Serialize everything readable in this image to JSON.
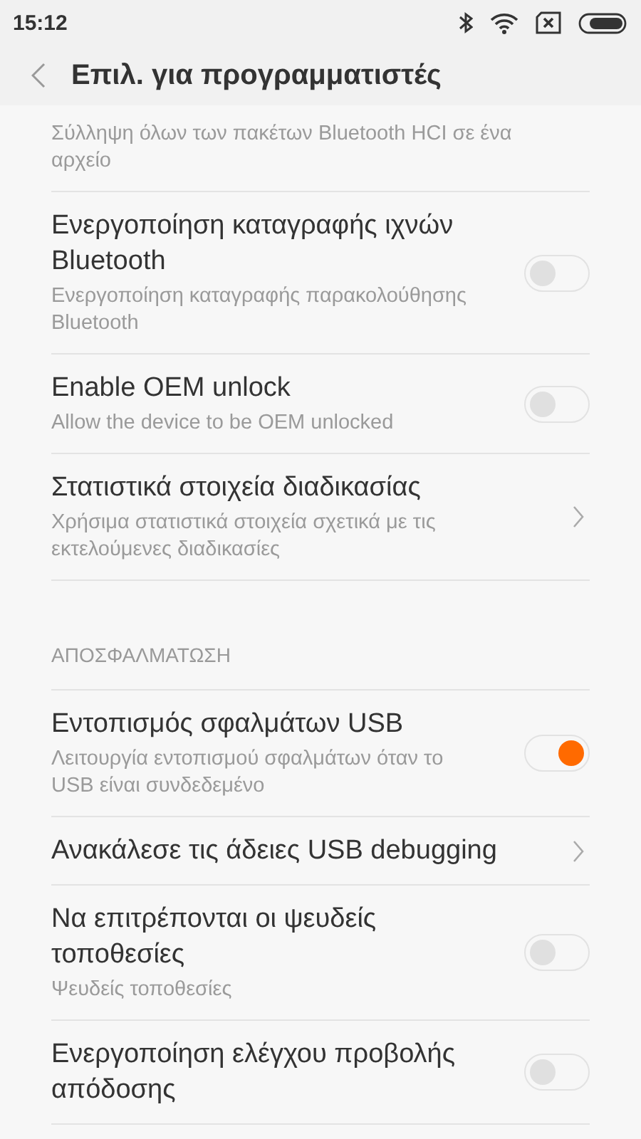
{
  "status_bar": {
    "time": "15:12"
  },
  "header": {
    "title": "Επιλ. για προγραμματιστές"
  },
  "sections": [
    {
      "items": [
        {
          "kind": "partial",
          "subtitle": "Σύλληψη όλων των πακέτων Bluetooth HCI σε ένα αρχείο"
        },
        {
          "kind": "toggle",
          "title": "Ενεργοποίηση καταγραφής ιχνών Bluetooth",
          "subtitle": "Ενεργοποίηση καταγραφής παρακολούθησης Bluetooth",
          "on": false
        },
        {
          "kind": "toggle",
          "title": "Enable OEM unlock",
          "subtitle": "Allow the device to be OEM unlocked",
          "on": false
        },
        {
          "kind": "link",
          "title": "Στατιστικά στοιχεία διαδικασίας",
          "subtitle": "Χρήσιμα στατιστικά στοιχεία σχετικά με τις εκτελούμενες διαδικασίες"
        }
      ]
    },
    {
      "header": "ΑΠΟΣΦΑΛΜΑΤΩΣΗ",
      "items": [
        {
          "kind": "toggle",
          "title": "Εντοπισμός σφαλμάτων USB",
          "subtitle": "Λειτουργία εντοπισμού σφαλμάτων όταν το USB είναι συνδεδεμένο",
          "on": true
        },
        {
          "kind": "link",
          "title": "Ανακάλεσε τις άδειες USB debugging"
        },
        {
          "kind": "toggle",
          "title": "Να επιτρέπονται οι ψευδείς τοποθεσίες",
          "subtitle": "Ψευδείς τοποθεσίες",
          "on": false
        },
        {
          "kind": "toggle",
          "title": "Ενεργοποίηση ελέγχου προβολής απόδοσης",
          "on": false
        }
      ]
    }
  ]
}
